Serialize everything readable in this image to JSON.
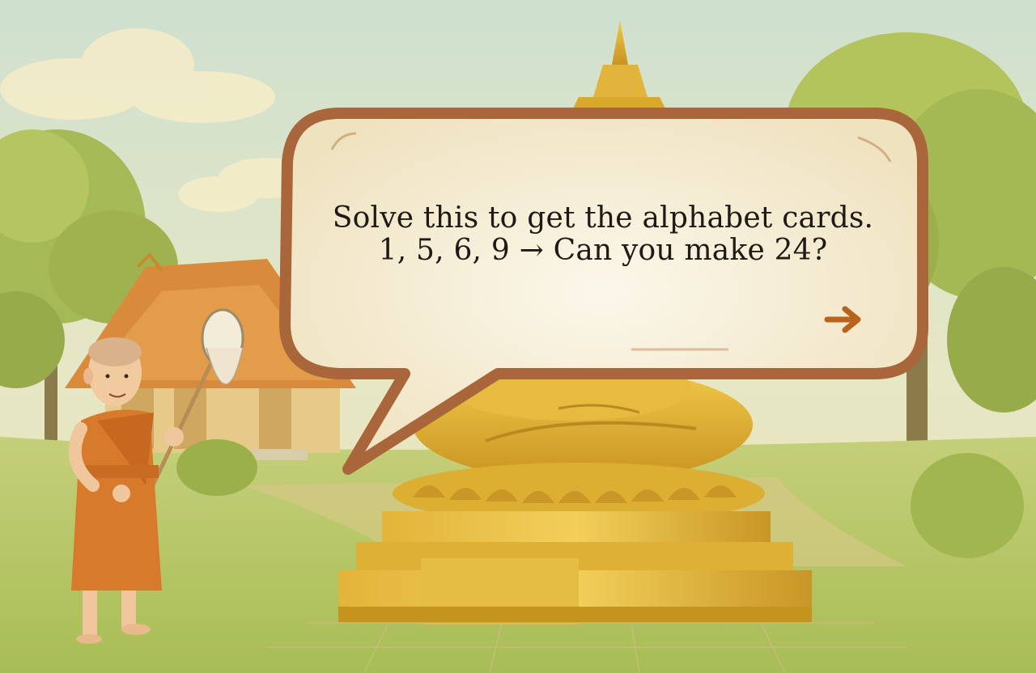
{
  "dialog": {
    "line1": "Solve this to get the alphabet cards.",
    "line2": "1, 5, 6, 9 → Can you make 24?"
  },
  "next_button": {
    "icon": "arrow-right-icon",
    "color": "#b8641f"
  },
  "scene": {
    "characters": [
      "monk",
      "buddha-statue"
    ],
    "colors": {
      "sky": "#dfe6c9",
      "grass": "#b5c56a",
      "gold": "#d9a92d",
      "robe": "#d87a2c",
      "bubble_border": "#a8663a",
      "bubble_fill": "#f7f0dc"
    }
  }
}
